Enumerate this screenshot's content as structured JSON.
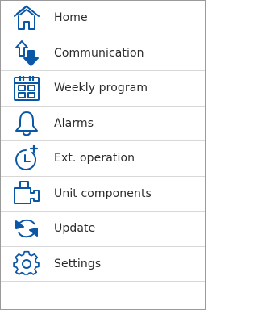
{
  "menu": {
    "items": [
      {
        "id": "home",
        "label": "Home",
        "icon": "home-icon"
      },
      {
        "id": "communication",
        "label": "Communication",
        "icon": "communication-icon"
      },
      {
        "id": "weekly-program",
        "label": "Weekly program",
        "icon": "calendar-icon"
      },
      {
        "id": "alarms",
        "label": "Alarms",
        "icon": "bell-icon"
      },
      {
        "id": "ext-operation",
        "label": "Ext. operation",
        "icon": "clock-plus-icon"
      },
      {
        "id": "unit-components",
        "label": "Unit components",
        "icon": "components-icon"
      },
      {
        "id": "update",
        "label": "Update",
        "icon": "update-icon"
      },
      {
        "id": "settings",
        "label": "Settings",
        "icon": "gear-icon"
      }
    ]
  },
  "colors": {
    "icon_stroke": "#0a57a8",
    "text": "#2b2b2b",
    "divider": "#d8d8d8",
    "border": "#9a9a9a"
  }
}
